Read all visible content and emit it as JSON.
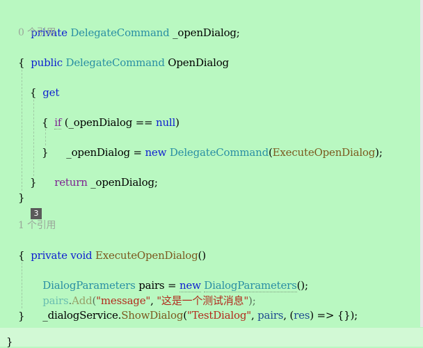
{
  "code": {
    "field_decl": {
      "kw": "private",
      "type": "DelegateCommand",
      "name": " _openDialog;"
    },
    "refs0": "0 个引用",
    "prop_decl": {
      "kw": "public",
      "type": "DelegateCommand",
      "name": " OpenDialog"
    },
    "brace_open": "{",
    "get_kw": "get",
    "brace_get_open": "{",
    "if_line": {
      "kw": "if",
      "cond_a": " (_openDialog == ",
      "null": "null",
      "cond_b": ")"
    },
    "brace_if_open": "{",
    "assign_line": {
      "lhs": "_openDialog = ",
      "new_kw": "new",
      "type": "DelegateCommand",
      "paren_open": "(",
      "arg": "ExecuteOpenDialog",
      "paren_close": ");"
    },
    "brace_if_close": "}",
    "return_line": {
      "kw": "return",
      "rest": " _openDialog;"
    },
    "brace_get_close": "}",
    "brace_close": "}",
    "badge": "3",
    "refs1": "1 个引用",
    "method_decl": {
      "kw1": "private",
      "kw2": "void",
      "name": "ExecuteOpenDialog",
      "params": "()"
    },
    "brace_m_open": "{",
    "params_line": {
      "type": "DialogParameters",
      "var": " pairs = ",
      "new_kw": "new",
      "type2": "DialogParameters",
      "end": "();"
    },
    "add_line": {
      "obj": "pairs",
      "dot": ".",
      "method": "Add",
      "open": "(",
      "s1": "\"message\"",
      "comma": ", ",
      "s2": "\"这是一个测试消息\"",
      "close": ");"
    },
    "show_line": {
      "obj": "_dialogService",
      "dot": ".",
      "method": "ShowDialog",
      "open": "(",
      "s1": "\"TestDialog\"",
      "comma": ", ",
      "arg2": "pairs",
      "mid": ", (",
      "arg3": "res",
      "end": ") => {});"
    },
    "brace_m_close": "}",
    "caret_char": "}"
  },
  "colors": {
    "background": "#b9f8c1",
    "keyword": "#0e1fd0",
    "type": "#2a8fa3",
    "method": "#7b5a1f",
    "string": "#b22b1d"
  }
}
